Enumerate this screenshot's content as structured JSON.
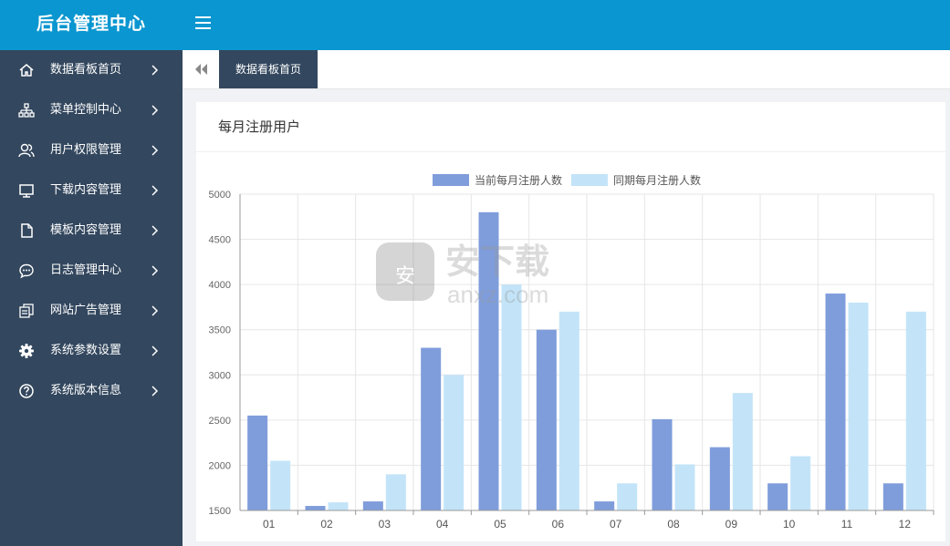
{
  "app": {
    "title": "后台管理中心"
  },
  "header": {
    "menu_icon": "hamburger-icon"
  },
  "sidebar": {
    "items": [
      {
        "label": "数据看板首页",
        "icon": "home-icon"
      },
      {
        "label": "菜单控制中心",
        "icon": "sitemap-icon"
      },
      {
        "label": "用户权限管理",
        "icon": "users-icon"
      },
      {
        "label": "下载内容管理",
        "icon": "monitor-icon"
      },
      {
        "label": "模板内容管理",
        "icon": "file-icon"
      },
      {
        "label": "日志管理中心",
        "icon": "chat-icon"
      },
      {
        "label": "网站广告管理",
        "icon": "money-icon"
      },
      {
        "label": "系统参数设置",
        "icon": "gear-icon"
      },
      {
        "label": "系统版本信息",
        "icon": "question-icon"
      }
    ]
  },
  "tabs": {
    "back_icon": "double-left-arrow-icon",
    "active_label": "数据看板首页"
  },
  "panel": {
    "title": "每月注册用户"
  },
  "watermark": {
    "text_top": "安下载",
    "text_bottom": "anxz.com"
  },
  "chart_data": {
    "type": "bar",
    "title": "",
    "xlabel": "",
    "ylabel": "",
    "categories": [
      "01",
      "02",
      "03",
      "04",
      "05",
      "06",
      "07",
      "08",
      "09",
      "10",
      "11",
      "12"
    ],
    "series": [
      {
        "name": "当前每月注册人数",
        "color": "#7f9ddb",
        "values": [
          2550,
          1550,
          1600,
          3300,
          4800,
          3500,
          1600,
          2510,
          2200,
          1800,
          3900,
          1800
        ]
      },
      {
        "name": "同期每月注册人数",
        "color": "#c3e4f8",
        "values": [
          2050,
          1590,
          1900,
          3000,
          4000,
          3700,
          1800,
          2010,
          2800,
          2100,
          3800,
          3700
        ]
      }
    ],
    "ylim": [
      1500,
      5000
    ],
    "yticks": [
      1500,
      2000,
      2500,
      3000,
      3500,
      4000,
      4500,
      5000
    ],
    "grid": true,
    "legend": "top-center"
  }
}
